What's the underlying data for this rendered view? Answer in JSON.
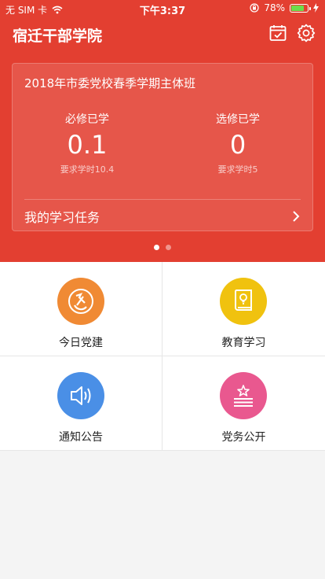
{
  "status": {
    "carrier": "无 SIM 卡",
    "time": "下午3:37",
    "battery": "78%",
    "battery_level": 0.78,
    "battery_color": "#6ddc4b"
  },
  "app": {
    "title": "宿迁干部学院",
    "icons": [
      "calendar-check-icon",
      "gear-icon"
    ],
    "theme_color": "#e33f31"
  },
  "card": {
    "title": "2018年市委党校春季学期主体班",
    "required": {
      "label": "必修已学",
      "value": "0.1",
      "requirement": "要求学时10.4"
    },
    "elective": {
      "label": "选修已学",
      "value": "0",
      "requirement": "要求学时5"
    },
    "task_label": "我的学习任务"
  },
  "pager": {
    "count": 2,
    "active": 0
  },
  "grid": [
    {
      "label": "今日党建",
      "icon": "party-emblem-icon",
      "color": "#f08a34"
    },
    {
      "label": "教育学习",
      "icon": "book-lightbulb-icon",
      "color": "#f0c20f"
    },
    {
      "label": "通知公告",
      "icon": "speaker-icon",
      "color": "#4a8fe6"
    },
    {
      "label": "党务公开",
      "icon": "star-lines-icon",
      "color": "#e9588f"
    }
  ]
}
